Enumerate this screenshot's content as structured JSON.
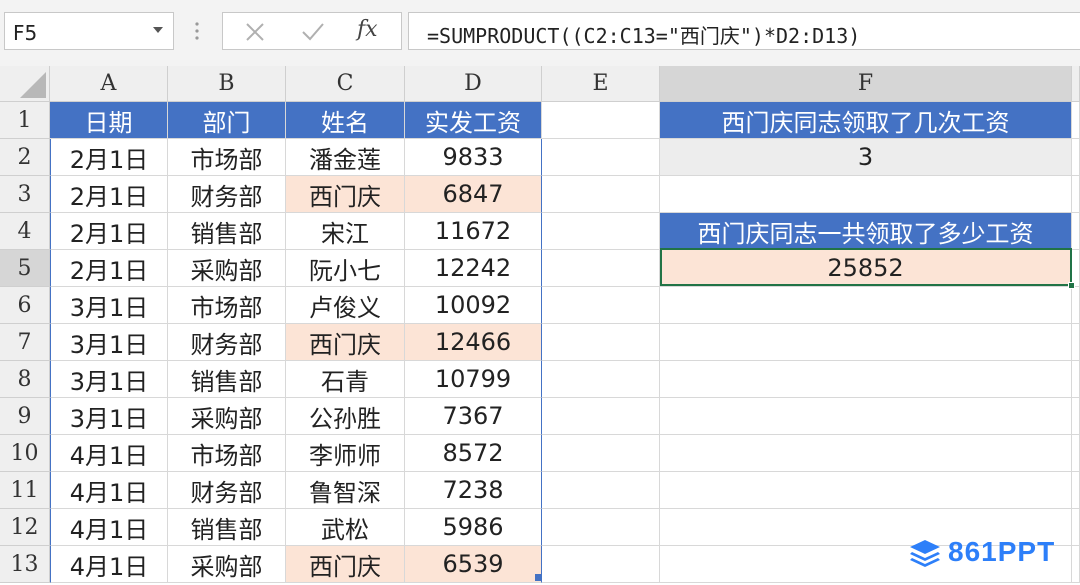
{
  "formula_bar": {
    "name_box": "F5",
    "cancel_icon": "cancel-icon",
    "enter_icon": "check-icon",
    "fx_label": "fx",
    "formula": "=SUMPRODUCT((C2:C13=\"西门庆\")*D2:D13)"
  },
  "columns": [
    "A",
    "B",
    "C",
    "D",
    "E",
    "F"
  ],
  "rows": [
    "1",
    "2",
    "3",
    "4",
    "5",
    "6",
    "7",
    "8",
    "9",
    "10",
    "11",
    "12",
    "13"
  ],
  "table": {
    "headers": [
      "日期",
      "部门",
      "姓名",
      "实发工资"
    ],
    "rows": [
      [
        "2月1日",
        "市场部",
        "潘金莲",
        "9833"
      ],
      [
        "2月1日",
        "财务部",
        "西门庆",
        "6847"
      ],
      [
        "2月1日",
        "销售部",
        "宋江",
        "11672"
      ],
      [
        "2月1日",
        "采购部",
        "阮小七",
        "12242"
      ],
      [
        "3月1日",
        "市场部",
        "卢俊义",
        "10092"
      ],
      [
        "3月1日",
        "财务部",
        "西门庆",
        "12466"
      ],
      [
        "3月1日",
        "销售部",
        "石青",
        "10799"
      ],
      [
        "3月1日",
        "采购部",
        "公孙胜",
        "7367"
      ],
      [
        "4月1日",
        "市场部",
        "李师师",
        "8572"
      ],
      [
        "4月1日",
        "财务部",
        "鲁智深",
        "7238"
      ],
      [
        "4月1日",
        "销售部",
        "武松",
        "5986"
      ],
      [
        "4月1日",
        "采购部",
        "西门庆",
        "6539"
      ]
    ]
  },
  "summary": {
    "q1": "西门庆同志领取了几次工资",
    "a1": "3",
    "q2": "西门庆同志一共领取了多少工资",
    "a2": "25852"
  },
  "colors": {
    "header_blue": "#4472c4",
    "highlight_pink": "#fce4d6",
    "answer_gray": "#ededed",
    "selection_green": "#217346"
  },
  "watermark": "861PPT"
}
